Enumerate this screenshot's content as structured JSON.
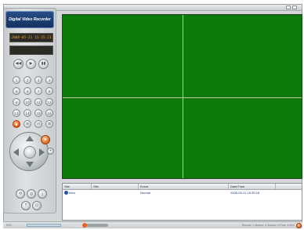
{
  "app": {
    "logo_text": "Digital Video Recorder"
  },
  "panel": {
    "lcd_datetime": "2008-05-21 15:35:21",
    "lcd_second": "",
    "transport_buttons": [
      {
        "name": "rewind-button",
        "glyph": "◀◀"
      },
      {
        "name": "play-button",
        "glyph": "▶"
      },
      {
        "name": "pause-button",
        "glyph": "▮▮"
      }
    ],
    "keypad": [
      [
        "1",
        "2",
        "3",
        "4"
      ],
      [
        "5",
        "6",
        "7",
        "8"
      ],
      [
        "9",
        "10",
        "11",
        "12"
      ],
      [
        "13",
        "14",
        "15",
        "16"
      ],
      [
        "■",
        "⊞",
        "⊟",
        "⊠"
      ]
    ],
    "ptz_center_label": "",
    "ptz_side_label": "",
    "bottom_buttons_row1": [
      "⟲",
      "◎",
      "⤓"
    ],
    "bottom_buttons_row2": [
      "⤒",
      "⏻"
    ]
  },
  "video": {
    "grid": "2x2",
    "background_color": "#0b7a0b"
  },
  "event_list": {
    "columns": [
      "Site",
      "Site",
      "Event",
      "Date/Time"
    ],
    "rows": [
      {
        "site": "Intro",
        "site2": "",
        "event": "Normal",
        "datetime": "2008-05-21 15:35:18"
      }
    ]
  },
  "statusbar": {
    "left_text": "REC",
    "progress": 0.0,
    "volume": 0.35,
    "right_text": "Record: 1   Motion: 0   Sensor: 0   Free: 100%"
  }
}
